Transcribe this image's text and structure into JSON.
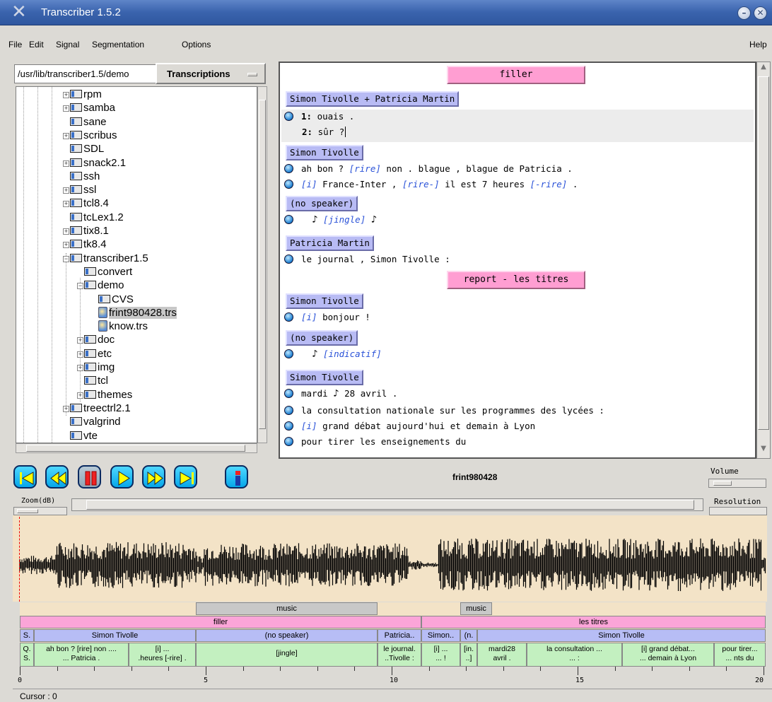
{
  "window": {
    "title": "Transcriber 1.5.2"
  },
  "menu": [
    "File",
    "Edit",
    "Signal",
    "Segmentation",
    "Options"
  ],
  "menu_help": "Help",
  "file_browser": {
    "path": "/usr/lib/transcriber1.5/demo",
    "filter_label": "Transcriptions",
    "items": [
      {
        "label": "rpm",
        "expandable": true
      },
      {
        "label": "samba",
        "expandable": true
      },
      {
        "label": "sane",
        "expandable": false
      },
      {
        "label": "scribus",
        "expandable": true
      },
      {
        "label": "SDL",
        "expandable": false
      },
      {
        "label": "snack2.1",
        "expandable": true
      },
      {
        "label": "ssh",
        "expandable": false
      },
      {
        "label": "ssl",
        "expandable": true
      },
      {
        "label": "tcl8.4",
        "expandable": true
      },
      {
        "label": "tcLex1.2",
        "expandable": false
      },
      {
        "label": "tix8.1",
        "expandable": true
      },
      {
        "label": "tk8.4",
        "expandable": true
      },
      {
        "label": "transcriber1.5",
        "expandable": true
      },
      {
        "label": "convert",
        "expandable": false
      },
      {
        "label": "demo",
        "expandable": true
      },
      {
        "label": "CVS",
        "expandable": false
      },
      {
        "label": "frint980428.trs",
        "expandable": false
      },
      {
        "label": "know.trs",
        "expandable": false
      },
      {
        "label": "doc",
        "expandable": true
      },
      {
        "label": "etc",
        "expandable": true
      },
      {
        "label": "img",
        "expandable": true
      },
      {
        "label": "tcl",
        "expandable": false
      },
      {
        "label": "themes",
        "expandable": true
      },
      {
        "label": "treectrl2.1",
        "expandable": true
      },
      {
        "label": "valgrind",
        "expandable": false
      },
      {
        "label": "vte",
        "expandable": false
      }
    ]
  },
  "editor": {
    "sections": [
      "filler",
      "report - les titres"
    ],
    "speakers": [
      "Simon Tivolle + Patricia Martin",
      "Simon Tivolle",
      "(no speaker)",
      "Patricia Martin",
      "Simon Tivolle",
      "(no speaker)",
      "Simon Tivolle"
    ],
    "overlap": [
      {
        "num": "1:",
        "text": "ouais ."
      },
      {
        "num": "2:",
        "text": "sûr ?"
      }
    ],
    "lines": {
      "l1a": "ah bon ? ",
      "l1b": "[rire]",
      "l1c": " non . blague , blague de Patricia .",
      "l2a": "[i]",
      "l2b": " France-Inter , ",
      "l2c": "[rire-]",
      "l2d": " il est 7 heures ",
      "l2e": "[-rire]",
      "l2f": " .",
      "l3": "[jingle]",
      "l4": "le journal , Simon Tivolle :",
      "l5a": "[i]",
      "l5b": " bonjour !",
      "l6": "[indicatif]",
      "l7a": "mardi ",
      "l7b": " 28 avril .",
      "l8": "la consultation nationale sur les programmes des lycées :",
      "l9a": "[i]",
      "l9b": " grand débat aujourd'hui et demain à Lyon",
      "l10": "pour tirer les enseignements du"
    }
  },
  "player": {
    "filename": "frint980428",
    "volume_label": "Volume",
    "zoom_label": "Zoom(dB)",
    "resolution_label": "Resolution",
    "buttons": [
      "skip-start-icon",
      "rewind-icon",
      "pause-icon",
      "play-icon",
      "fast-forward-icon",
      "skip-end-icon",
      "info-icon"
    ]
  },
  "timeline": {
    "music": [
      "music",
      "music"
    ],
    "section": [
      "filler",
      "les titres"
    ],
    "speaker": [
      "S.",
      "Simon Tivolle",
      "(no speaker)",
      "Patricia..",
      "Simon..",
      "(n.",
      "Simon Tivolle"
    ],
    "segments": [
      {
        "l1": "Q.",
        "l2": "S."
      },
      {
        "l1": "ah bon ? [rire] non ....",
        "l2": "... Patricia ."
      },
      {
        "l1": "[i] ...",
        "l2": ".heures [-rire] ."
      },
      {
        "l1": "[jingle]",
        "l2": ""
      },
      {
        "l1": "le journal.",
        "l2": "..Tivolle :"
      },
      {
        "l1": "[i] ...",
        "l2": "... !"
      },
      {
        "l1": "[in.",
        "l2": "..]"
      },
      {
        "l1": "mardi28",
        "l2": "avril ."
      },
      {
        "l1": "la consultation ...",
        "l2": "... :"
      },
      {
        "l1": "[i] grand débat...",
        "l2": "... demain à Lyon"
      },
      {
        "l1": "pour tirer...",
        "l2": "... nts du"
      }
    ],
    "axis": [
      "0",
      "5",
      "10",
      "15",
      "20"
    ]
  },
  "status": {
    "cursor": "Cursor : 0"
  }
}
